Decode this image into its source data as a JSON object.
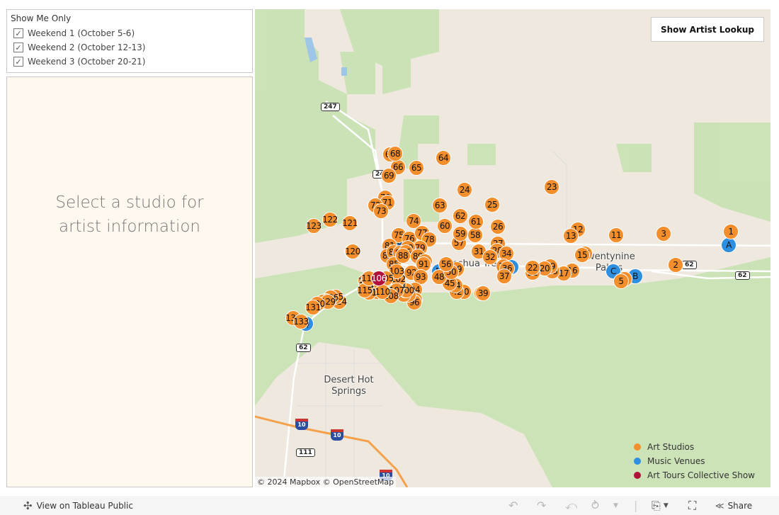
{
  "filter": {
    "title": "Show Me Only",
    "options": [
      {
        "label": "Weekend 1 (October 5-6)",
        "checked": true
      },
      {
        "label": "Weekend 2 (October 12-13)",
        "checked": true
      },
      {
        "label": "Weekend 3 (October 20-21)",
        "checked": true
      }
    ]
  },
  "info": {
    "placeholder": "Select a studio for artist information"
  },
  "map": {
    "lookup_button": "Show Artist Lookup",
    "places": [
      "Joshua Tree",
      "Twentynine Palms",
      "Desert Hot Springs"
    ],
    "shields": [
      "247",
      "24",
      "62",
      "62",
      "62"
    ],
    "interstates": [
      "10",
      "10",
      "10"
    ],
    "state_route": "111",
    "attribution": [
      "© 2024 Mapbox",
      "© OpenStreetMap"
    ],
    "colors": {
      "studio": "#f28e2b",
      "venue": "#2e8ee0",
      "collective": "#b0103a"
    },
    "studios": [
      "1",
      "2",
      "3",
      "4",
      "5",
      "11",
      "12",
      "13",
      "14",
      "15",
      "16",
      "17",
      "18",
      "19",
      "20",
      "21",
      "22",
      "23",
      "24",
      "25",
      "26",
      "27",
      "28",
      "31",
      "32",
      "34",
      "35",
      "36",
      "37",
      "38",
      "39",
      "40",
      "42",
      "44",
      "45",
      "48",
      "49",
      "50",
      "56",
      "57",
      "58",
      "59",
      "60",
      "61",
      "62",
      "63",
      "64",
      "65",
      "66",
      "67",
      "68",
      "69",
      "70",
      "71",
      "72",
      "73",
      "74",
      "75",
      "76",
      "77",
      "78",
      "79",
      "80",
      "81",
      "82",
      "83",
      "84",
      "85",
      "86",
      "88",
      "89",
      "90",
      "91",
      "92",
      "93",
      "94",
      "95",
      "96",
      "97",
      "98",
      "99",
      "100",
      "101",
      "102",
      "103",
      "104",
      "105",
      "107",
      "108",
      "109",
      "110",
      "111",
      "112",
      "113",
      "114",
      "115",
      "116",
      "119",
      "120",
      "121",
      "122",
      "123",
      "124",
      "125",
      "126",
      "127",
      "128",
      "129",
      "130",
      "131",
      "132",
      "133"
    ],
    "venues": [
      "A",
      "B",
      "C",
      "K",
      "M",
      "N",
      "Q"
    ],
    "collective": [
      "106"
    ]
  },
  "legend": [
    {
      "label": "Art Studios",
      "color": "#f28e2b"
    },
    {
      "label": "Music Venues",
      "color": "#2e8ee0"
    },
    {
      "label": "Art Tours Collective Show",
      "color": "#b0103a"
    }
  ],
  "toolbar": {
    "view_label": "View on Tableau Public",
    "share_label": "Share"
  }
}
